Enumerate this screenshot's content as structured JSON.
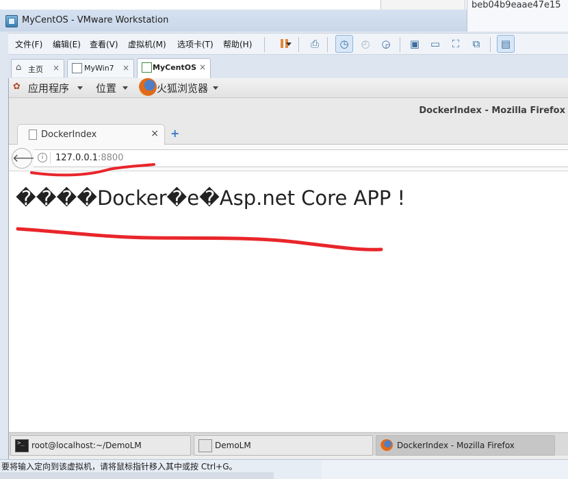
{
  "window": {
    "title": "MyCentOS - VMware Workstation",
    "side_text": "beb04b9eaae47e15"
  },
  "menubar": {
    "items": [
      "文件(F)",
      "编辑(E)",
      "查看(V)",
      "虚拟机(M)",
      "选项卡(T)",
      "帮助(H)"
    ]
  },
  "vm_tabs": [
    {
      "label": "主页"
    },
    {
      "label": "MyWin7"
    },
    {
      "label": "MyCentOS"
    }
  ],
  "gnome": {
    "apps": "应用程序",
    "places": "位置",
    "browser": "火狐浏览器"
  },
  "firefox": {
    "window_title": "DockerIndex - Mozilla Firefox",
    "tab_label": "DockerIndex",
    "new_tab": "+",
    "url_host": "127.0.0.1",
    "url_port": ":8800",
    "heading": "����Docker�e�Asp.net Core APP !"
  },
  "taskbar": [
    {
      "label": "root@localhost:~/DemoLM"
    },
    {
      "label": "DemoLM"
    },
    {
      "label": "DockerIndex - Mozilla Firefox"
    }
  ],
  "status": {
    "hint": "要将输入定向到该虚拟机，请将鼠标指针移入其中或按 Ctrl+G。"
  },
  "colors": {
    "annotation_red": "#e8262b",
    "firefox_link_blue": "#3a78c7",
    "vmware_accent": "#e2883d"
  }
}
